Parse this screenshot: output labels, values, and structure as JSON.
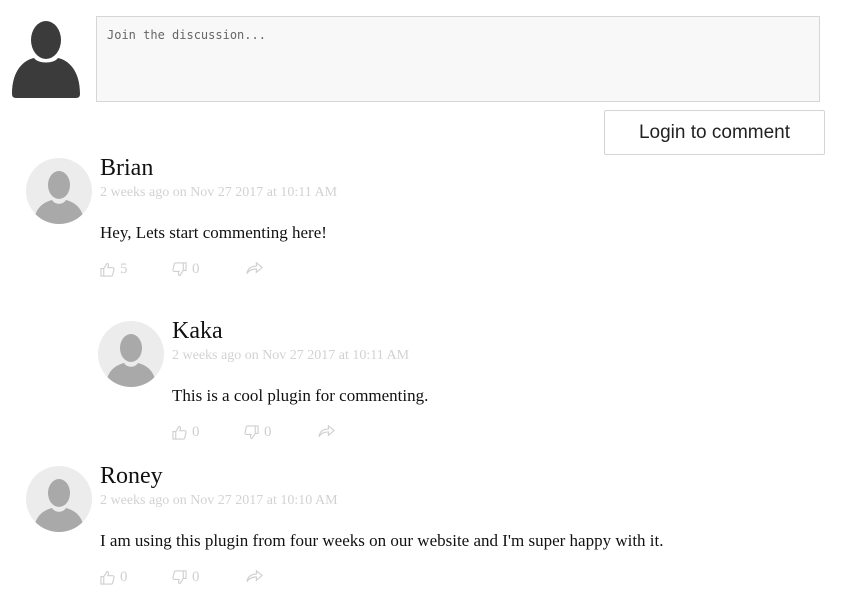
{
  "composer": {
    "placeholder": "Join the discussion...",
    "login_label": "Login to comment"
  },
  "comments": [
    {
      "author": "Brian",
      "timestamp": "2 weeks ago on Nov 27 2017 at 10:11 AM",
      "text": "Hey, Lets start commenting here!",
      "likes": "5",
      "dislikes": "0"
    },
    {
      "author": "Kaka",
      "timestamp": "2 weeks ago on Nov 27 2017 at 10:11 AM",
      "text": "This is a cool plugin for commenting.",
      "likes": "0",
      "dislikes": "0"
    },
    {
      "author": "Roney",
      "timestamp": "2 weeks ago on Nov 27 2017 at 10:10 AM",
      "text": "I am using this plugin from four weeks on our website and I'm super happy with it.",
      "likes": "0",
      "dislikes": "0"
    }
  ],
  "icons": {
    "avatar": "user-silhouette-icon",
    "like": "thumbs-up-icon",
    "dislike": "thumbs-down-icon",
    "share": "share-arrow-icon"
  },
  "colors": {
    "composer_avatar": "#3b3b3b",
    "comment_avatar_bg": "#ececec",
    "comment_avatar_figure": "#a9a9a9",
    "muted_text": "#d2d2d2",
    "action_icon": "#d0d0d0"
  }
}
